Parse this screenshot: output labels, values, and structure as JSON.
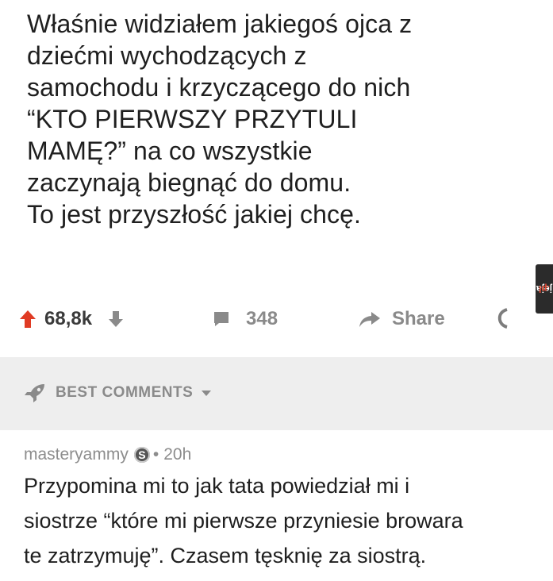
{
  "post": {
    "text": "Właśnie widziałem jakiegoś ojca z\ndziećmi wychodzących z\nsamochodu i krzyczącego do nich\n“KTO PIERWSZY PRZYTULI\nMAMĘ?” na co wszystkie\nzaczynają biegnąć do domu.\nTo jest przyszłość jakiej chcę."
  },
  "watermark": {
    "brand": "jeja",
    "tld": ".pl"
  },
  "actions": {
    "votes": "68,8k",
    "comments": "348",
    "share": "Share"
  },
  "best": {
    "label": "BEST COMMENTS"
  },
  "comment": {
    "author": "masteryammy",
    "separator": "•",
    "time": "20h",
    "text": "Przypomina mi to jak tata powiedział mi i\nsiostrze “które mi pierwsze przyniesie browara\nte zatrzymuję”. Czasem tęsknię za siostrą."
  },
  "colors": {
    "text": "#1f1f1f",
    "muted": "#8a8a8a",
    "band": "#eeeeee",
    "upvote": "#e03b24"
  }
}
